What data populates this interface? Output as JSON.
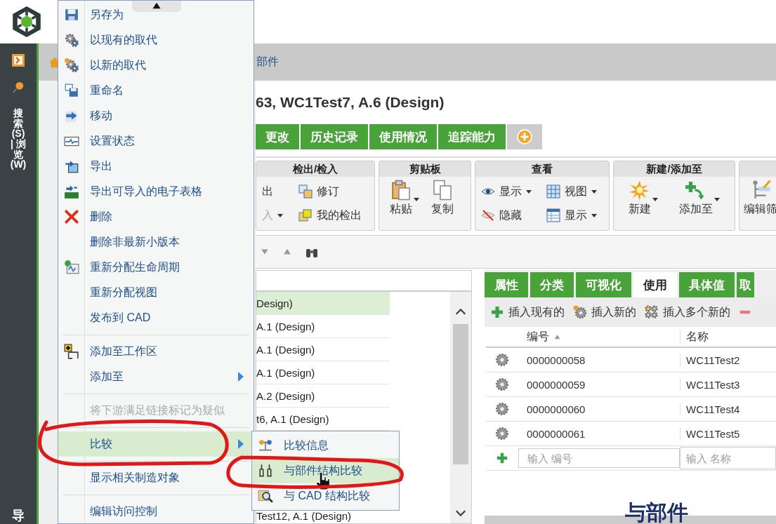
{
  "sidebar": {
    "nav_label": "搜索(S) | 浏览(W)",
    "bottom_label": "导"
  },
  "breadcrumb": {
    "text": "部件"
  },
  "title": "63, WC1Test7, A.6 (Design)",
  "tabs": [
    {
      "label": "更改",
      "selected": false
    },
    {
      "label": "历史记录",
      "selected": false
    },
    {
      "label": "使用情况",
      "selected": false
    },
    {
      "label": "追踪能力",
      "selected": false
    }
  ],
  "toolbar": [
    {
      "title": "检出/检入",
      "kind": "small",
      "items": [
        {
          "label": "出",
          "dropdown": false,
          "disabled": false
        },
        {
          "label": "修订",
          "dropdown": false,
          "disabled": false
        },
        {
          "label": "入",
          "dropdown": true,
          "disabled": true
        },
        {
          "label": "我的检出",
          "dropdown": false,
          "disabled": false
        }
      ]
    },
    {
      "title": "剪贴板",
      "kind": "large",
      "items": [
        {
          "label": "粘贴",
          "dropdown": true,
          "disabled": false
        },
        {
          "label": "复制",
          "dropdown": false,
          "disabled": false
        }
      ]
    },
    {
      "title": "查看",
      "kind": "small",
      "items": [
        {
          "label": "显示",
          "dropdown": true,
          "disabled": false
        },
        {
          "label": "视图",
          "dropdown": true,
          "disabled": false
        },
        {
          "label": "隐藏",
          "dropdown": false,
          "disabled": false
        },
        {
          "label": "显示",
          "dropdown": true,
          "disabled": false
        }
      ]
    },
    {
      "title": "新建/添加至",
      "kind": "large",
      "items": [
        {
          "label": "新建",
          "dropdown": true,
          "disabled": false
        },
        {
          "label": "添加至",
          "dropdown": true,
          "disabled": false
        }
      ]
    },
    {
      "kind": "large",
      "items": [
        {
          "label": "编辑筛",
          "dropdown": false,
          "disabled": false
        }
      ]
    }
  ],
  "tree": {
    "rows": [
      {
        "text": "Design)",
        "selected": true
      },
      {
        "text": "A.1 (Design)",
        "selected": false
      },
      {
        "text": "A.1 (Design)",
        "selected": false
      },
      {
        "text": "A.1 (Design)",
        "selected": false
      },
      {
        "text": "A.2 (Design)",
        "selected": false
      },
      {
        "text": "t6, A.1 (Design)",
        "selected": false
      }
    ],
    "last_row": "Test12, A.1 (Design)"
  },
  "details": {
    "tabs": [
      {
        "label": "属性",
        "selected": false
      },
      {
        "label": "分类",
        "selected": false
      },
      {
        "label": "可视化",
        "selected": false
      },
      {
        "label": "使用",
        "selected": true
      },
      {
        "label": "具体值",
        "selected": false
      },
      {
        "label": "取",
        "selected": false
      }
    ],
    "actions": [
      "插入现有的",
      "插入新的",
      "插入多个新的"
    ],
    "columns": [
      "编号",
      "名称"
    ],
    "rows": [
      {
        "number": "0000000058",
        "name": "WC11Test2"
      },
      {
        "number": "0000000059",
        "name": "WC11Test3"
      },
      {
        "number": "0000000060",
        "name": "WC11Test4"
      },
      {
        "number": "0000000061",
        "name": "WC11Test5"
      }
    ],
    "input_placeholders": [
      "输入 编号",
      "输入 名称"
    ]
  },
  "menu": [
    {
      "kind": "item",
      "label": "另存为",
      "disabled": false,
      "selected": false,
      "submenu": false
    },
    {
      "kind": "item",
      "label": "以现有的取代",
      "disabled": false,
      "selected": false,
      "submenu": false
    },
    {
      "kind": "item",
      "label": "以新的取代",
      "disabled": false,
      "selected": false,
      "submenu": false
    },
    {
      "kind": "item",
      "label": "重命名",
      "disabled": false,
      "selected": false,
      "submenu": false
    },
    {
      "kind": "item",
      "label": "移动",
      "disabled": false,
      "selected": false,
      "submenu": false
    },
    {
      "kind": "item",
      "label": "设置状态",
      "disabled": false,
      "selected": false,
      "submenu": false
    },
    {
      "kind": "item",
      "label": "导出",
      "disabled": false,
      "selected": false,
      "submenu": false
    },
    {
      "kind": "item",
      "label": "导出可导入的电子表格",
      "disabled": false,
      "selected": false,
      "submenu": false
    },
    {
      "kind": "item",
      "label": "删除",
      "disabled": false,
      "selected": false,
      "submenu": false
    },
    {
      "kind": "item",
      "label": "删除非最新小版本",
      "disabled": false,
      "selected": false,
      "submenu": false
    },
    {
      "kind": "item",
      "label": "重新分配生命周期",
      "disabled": false,
      "selected": false,
      "submenu": false
    },
    {
      "kind": "item",
      "label": "重新分配视图",
      "disabled": false,
      "selected": false,
      "submenu": false
    },
    {
      "kind": "item",
      "label": "发布到 CAD",
      "disabled": false,
      "selected": false,
      "submenu": false
    },
    {
      "kind": "separator"
    },
    {
      "kind": "item",
      "label": "添加至工作区",
      "disabled": false,
      "selected": false,
      "submenu": false
    },
    {
      "kind": "item",
      "label": "添加至",
      "disabled": false,
      "selected": false,
      "submenu": true
    },
    {
      "kind": "separator"
    },
    {
      "kind": "item",
      "label": "将下游满足链接标记为疑似",
      "disabled": true,
      "selected": false,
      "submenu": false
    },
    {
      "kind": "separator"
    },
    {
      "kind": "item",
      "label": "比较",
      "disabled": false,
      "selected": true,
      "submenu": true
    },
    {
      "kind": "separator"
    },
    {
      "kind": "item",
      "label": "显示相关制造对象",
      "disabled": false,
      "selected": false,
      "submenu": false
    },
    {
      "kind": "separator"
    },
    {
      "kind": "item",
      "label": "编辑访问控制",
      "disabled": false,
      "selected": false,
      "submenu": false
    }
  ],
  "submenu": [
    {
      "label": "比较信息",
      "selected": false
    },
    {
      "label": "与部件结构比较",
      "selected": true
    },
    {
      "label": "与 CAD 结构比较",
      "selected": false
    }
  ],
  "caption": "与部件"
}
